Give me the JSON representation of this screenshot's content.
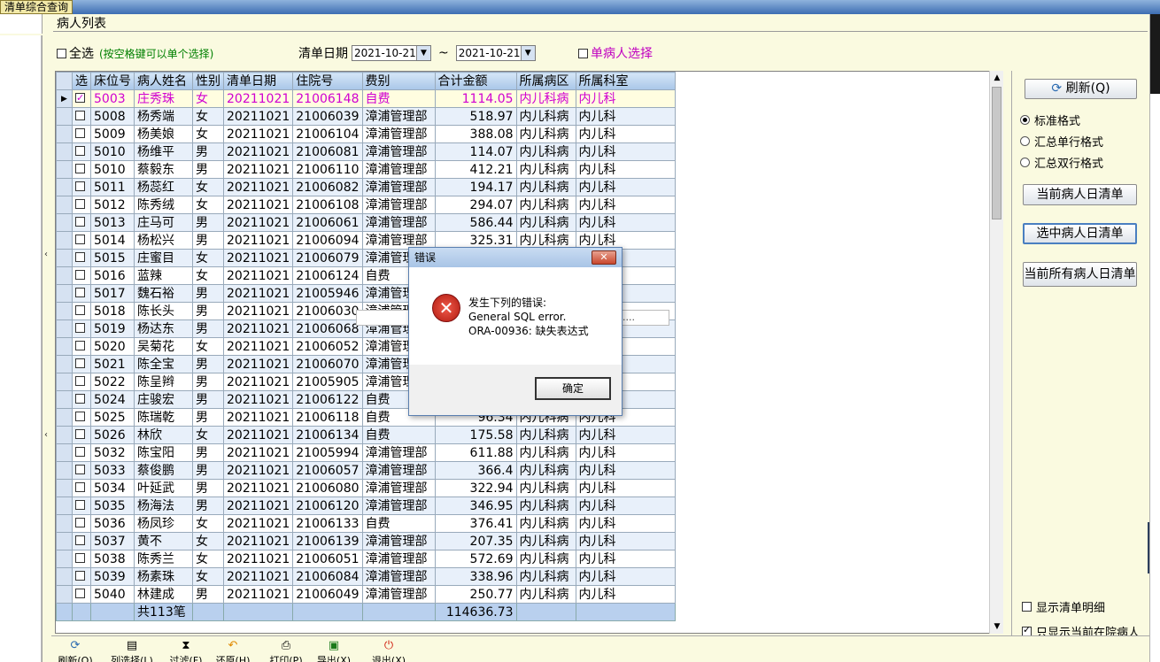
{
  "window": {
    "tab_title": "清单综合查询"
  },
  "group": {
    "label": "病人列表"
  },
  "filters": {
    "select_all_label": "全选",
    "hint": "(按空格键可以单个选择)",
    "date_label": "清单日期",
    "date_from": "2021-10-21",
    "tilde": "~",
    "date_to": "2021-10-21",
    "single_patient_label": "单病人选择"
  },
  "table": {
    "headers": [
      "选",
      "床位号",
      "病人姓名",
      "性别",
      "清单日期",
      "住院号",
      "费别",
      "合计金额",
      "所属病区",
      "所属科室"
    ],
    "rows": [
      [
        "5003",
        "庄秀珠",
        "女",
        "20211021",
        "21006148",
        "自费",
        "1114.05",
        "内儿科病",
        "内儿科"
      ],
      [
        "5008",
        "杨秀端",
        "女",
        "20211021",
        "21006039",
        "漳浦管理部",
        "518.97",
        "内儿科病",
        "内儿科"
      ],
      [
        "5009",
        "杨美娘",
        "女",
        "20211021",
        "21006104",
        "漳浦管理部",
        "388.08",
        "内儿科病",
        "内儿科"
      ],
      [
        "5010",
        "杨维平",
        "男",
        "20211021",
        "21006081",
        "漳浦管理部",
        "114.07",
        "内儿科病",
        "内儿科"
      ],
      [
        "5010",
        "蔡毅东",
        "男",
        "20211021",
        "21006110",
        "漳浦管理部",
        "412.21",
        "内儿科病",
        "内儿科"
      ],
      [
        "5011",
        "杨蕊红",
        "女",
        "20211021",
        "21006082",
        "漳浦管理部",
        "194.17",
        "内儿科病",
        "内儿科"
      ],
      [
        "5012",
        "陈秀绒",
        "女",
        "20211021",
        "21006108",
        "漳浦管理部",
        "294.07",
        "内儿科病",
        "内儿科"
      ],
      [
        "5013",
        "庄马可",
        "男",
        "20211021",
        "21006061",
        "漳浦管理部",
        "586.44",
        "内儿科病",
        "内儿科"
      ],
      [
        "5014",
        "杨松兴",
        "男",
        "20211021",
        "21006094",
        "漳浦管理部",
        "325.31",
        "内儿科病",
        "内儿科"
      ],
      [
        "5015",
        "庄蜜目",
        "女",
        "20211021",
        "21006079",
        "漳浦管理部",
        "",
        "",
        ""
      ],
      [
        "5016",
        "蓝辣",
        "女",
        "20211021",
        "21006124",
        "自费",
        "",
        "",
        ""
      ],
      [
        "5017",
        "魏石裕",
        "男",
        "20211021",
        "21005946",
        "漳浦管理",
        "",
        "",
        ""
      ],
      [
        "5018",
        "陈长头",
        "男",
        "20211021",
        "21006030",
        "漳浦管理",
        "",
        "",
        ""
      ],
      [
        "5019",
        "杨达东",
        "男",
        "20211021",
        "21006068",
        "漳浦管理",
        "",
        "",
        ""
      ],
      [
        "5020",
        "吴菊花",
        "女",
        "20211021",
        "21006052",
        "漳浦管理",
        "",
        "",
        ""
      ],
      [
        "5021",
        "陈全宝",
        "男",
        "20211021",
        "21006070",
        "漳浦管理",
        "",
        "",
        ""
      ],
      [
        "5022",
        "陈呈辫",
        "男",
        "20211021",
        "21005905",
        "漳浦管理",
        "",
        "",
        ""
      ],
      [
        "5024",
        "庄骏宏",
        "男",
        "20211021",
        "21006122",
        "自费",
        "",
        "",
        ""
      ],
      [
        "5025",
        "陈瑞乾",
        "男",
        "20211021",
        "21006118",
        "自费",
        "96.34",
        "内儿科病",
        "内儿科"
      ],
      [
        "5026",
        "林欣",
        "女",
        "20211021",
        "21006134",
        "自费",
        "175.58",
        "内儿科病",
        "内儿科"
      ],
      [
        "5032",
        "陈宝阳",
        "男",
        "20211021",
        "21005994",
        "漳浦管理部",
        "611.88",
        "内儿科病",
        "内儿科"
      ],
      [
        "5033",
        "蔡俊鹏",
        "男",
        "20211021",
        "21006057",
        "漳浦管理部",
        "366.4",
        "内儿科病",
        "内儿科"
      ],
      [
        "5034",
        "叶延武",
        "男",
        "20211021",
        "21006080",
        "漳浦管理部",
        "322.94",
        "内儿科病",
        "内儿科"
      ],
      [
        "5035",
        "杨海法",
        "男",
        "20211021",
        "21006120",
        "漳浦管理部",
        "346.95",
        "内儿科病",
        "内儿科"
      ],
      [
        "5036",
        "杨凤珍",
        "女",
        "20211021",
        "21006133",
        "自费",
        "376.41",
        "内儿科病",
        "内儿科"
      ],
      [
        "5037",
        "黄不",
        "女",
        "20211021",
        "21006139",
        "漳浦管理部",
        "207.35",
        "内儿科病",
        "内儿科"
      ],
      [
        "5038",
        "陈秀兰",
        "女",
        "20211021",
        "21006051",
        "漳浦管理部",
        "572.69",
        "内儿科病",
        "内儿科"
      ],
      [
        "5039",
        "杨素珠",
        "女",
        "20211021",
        "21006084",
        "漳浦管理部",
        "338.96",
        "内儿科病",
        "内儿科"
      ],
      [
        "5040",
        "林建成",
        "男",
        "20211021",
        "21006049",
        "漳浦管理部",
        "250.77",
        "内儿科病",
        "内儿科"
      ]
    ],
    "footer_count": "共113笔",
    "footer_total": "114636.73"
  },
  "right_panel": {
    "refresh_label": "刷新(Q)",
    "radios": [
      "标准格式",
      "汇总单行格式",
      "汇总双行格式"
    ],
    "btn_current_patient": "当前病人日清单",
    "btn_selected_patient": "选中病人日清单",
    "btn_all_patients": "当前所有病人日清单",
    "chk_show_detail": "显示清单明细",
    "chk_only_inpatients": "只显示当前在院病人"
  },
  "toolbar": {
    "refresh": "刷新(Q)",
    "column_select": "列选择(L)",
    "filter": "过滤(F)",
    "restore": "还原(H)",
    "print": "打印(P)",
    "export": "导出(X)",
    "exit": "退出(X)"
  },
  "dialog": {
    "title": "错误",
    "line1": "发生下列的错误:",
    "line2": "General SQL error.",
    "line3": "ORA-00936: 缺失表达式",
    "ok": "确定"
  },
  "colors": {
    "selected_row_text": "#d000d0",
    "hint_text": "#008000",
    "header_bg": "#b9d0ee"
  }
}
